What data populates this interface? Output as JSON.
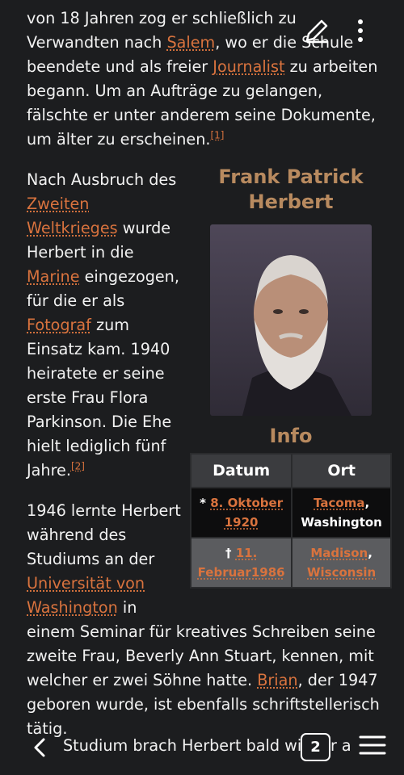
{
  "article": {
    "p1": {
      "t1": "von 18 Jahren zog er schließlich zu Verwandten nach ",
      "link1": "Salem",
      "t2": ", wo er die Schule beendete und als freier ",
      "link2": "Journalist",
      "t3": " zu arbeiten begann. Um an Aufträge zu gelangen, fälschte er unter anderem seine Dokumente, um älter zu erscheinen.",
      "ref": "[1]"
    },
    "p2": {
      "t1": "Nach Ausbruch des ",
      "link1": "Zweiten Weltkrieges",
      "t2": " wurde Herbert in die ",
      "link2": "Marine",
      "t3": " eingezogen, für die er als ",
      "link3": "Fotograf",
      "t4": " zum Einsatz kam. 1940 heiratete er seine erste Frau Flora Parkinson. Die Ehe hielt lediglich fünf Jahre.",
      "ref": "[2]"
    },
    "p3": {
      "t1": "1946 lernte Herbert während des Studiums an der ",
      "link1": "Universität von Washington",
      "t2": " in einem Seminar für kreatives Schreiben seine zweite Frau, Beverly Ann Stuart, kennen, mit welcher er zwei Söhne hatte. ",
      "link2": "Brian",
      "t3": ", der 1947 geboren wurde, ist ebenfalls schriftstellerisch tätig."
    }
  },
  "infobox": {
    "title": "Frank Patrick Herbert",
    "subtitle": "Info",
    "headers": [
      "Datum",
      "Ort"
    ],
    "birth_symbol": "*",
    "birth_date": "8. Oktober 1920",
    "birth_place_link": "Tacoma",
    "birth_place_rest": ", Washington",
    "death_symbol": "†",
    "death_date": "11. Februar1986",
    "death_place_link": "Madison",
    "death_place_sep": ",",
    "death_place_link2": "Wisconsin"
  },
  "bottom_bar": {
    "peek_text": "Studium brach Herbert bald wieder a",
    "tab_count": "2"
  },
  "icons": {
    "edit": "pencil-icon",
    "more": "more-vertical-icon",
    "back": "chevron-left-icon",
    "menu": "hamburger-menu-icon"
  },
  "colors": {
    "background": "#1c1d1f",
    "link": "#d9733e",
    "infobox_heading": "#b88a5f"
  }
}
